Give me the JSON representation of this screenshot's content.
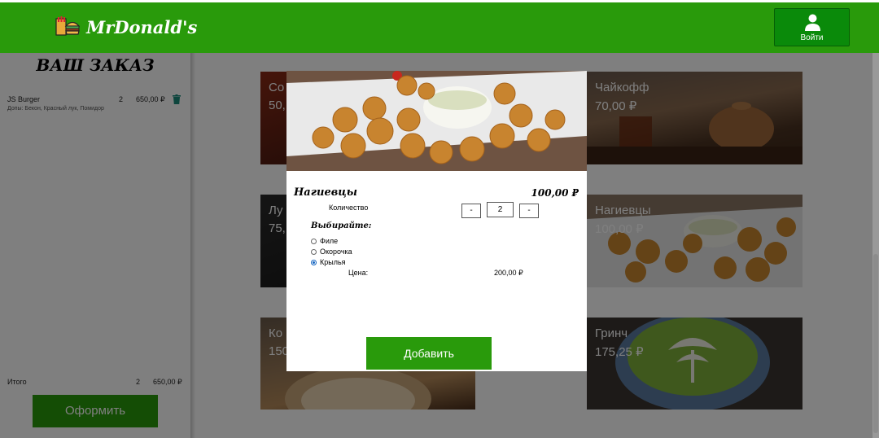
{
  "header": {
    "logo_text": "MrDonald's",
    "login_label": "Войти"
  },
  "order": {
    "title": "ВАШ ЗАКАЗ",
    "items": [
      {
        "name": "JS Burger",
        "quantity": "2",
        "price": "650,00 ₽",
        "extras": "Допы: Бекон, Красный лук, Помидор"
      }
    ],
    "total_label": "Итого",
    "total_count": "2",
    "total_sum": "650,00 ₽",
    "checkout_label": "Оформить"
  },
  "menu": {
    "items": [
      {
        "name": "Со",
        "price": "50,"
      },
      {
        "name": "Чайкофф",
        "price": "70,00 ₽"
      },
      {
        "name": "Лу",
        "price": "75,"
      },
      {
        "name": "Нагиевцы",
        "price": "100,00 ₽"
      },
      {
        "name": "Ко",
        "price": "150"
      },
      {
        "name": "Гринч",
        "price": "175,25 ₽"
      }
    ]
  },
  "modal": {
    "title": "Нагиевцы",
    "price": "100,00 ₽",
    "quantity_label": "Количество",
    "minus_label": "-",
    "plus_label": "-",
    "quantity_value": "2",
    "choose_label": "Выбирайте:",
    "options": [
      {
        "label": "Филе",
        "checked": false
      },
      {
        "label": "Окорочка",
        "checked": false
      },
      {
        "label": "Крылья",
        "checked": true
      }
    ],
    "price_label": "Цена:",
    "total_price": "200,00 ₽",
    "add_label": "Добавить"
  },
  "colors": {
    "brand_green": "#299a0b",
    "login_green": "#0a8a0a",
    "trash_teal": "#1a8a7a",
    "overlay": "rgba(0,0,0,0.5)"
  },
  "icons": {
    "logo": "burger-logo-icon",
    "user": "user-icon",
    "trash": "trash-icon"
  }
}
